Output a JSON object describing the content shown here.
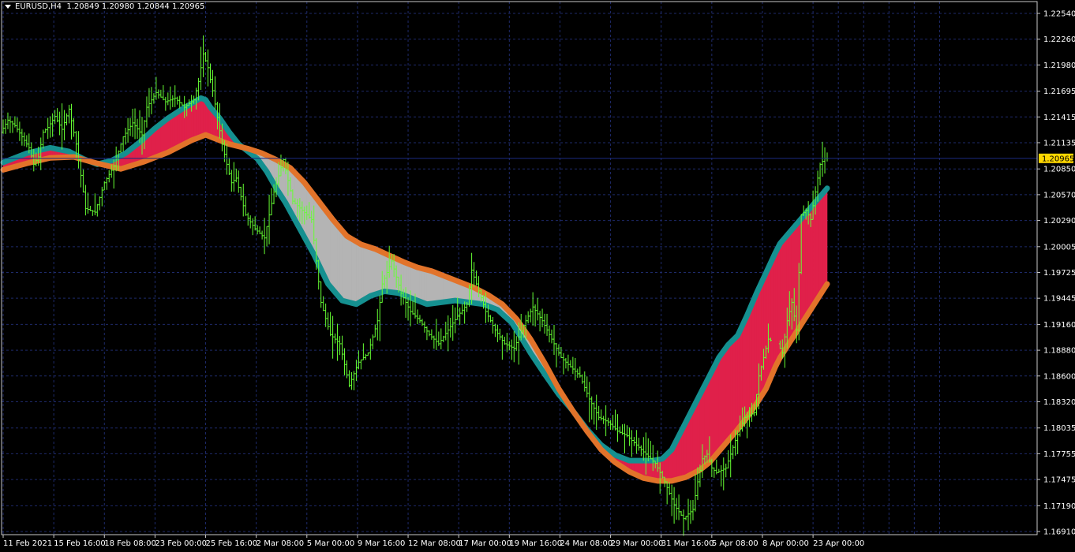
{
  "header": {
    "symbol": "EURUSD,H4",
    "ohlc": "1.20849 1.20980 1.20844 1.20965"
  },
  "colors": {
    "background": "#000000",
    "frame": "#c8c8c8",
    "grid": "#1e2a6a",
    "candle": "#66ff33",
    "fast_ma": "#159090",
    "slow_ma": "#e2732a",
    "bull_fill": "#e0204a",
    "bear_fill": "#b4b4b4",
    "price_line": "#1a2a80",
    "price_tag": "#ffd700"
  },
  "chart_data": {
    "type": "line",
    "current_price": "1.20965",
    "y_ticks": [
      "1.22540",
      "1.22260",
      "1.21980",
      "1.21695",
      "1.21415",
      "1.21135",
      "1.20850",
      "1.20570",
      "1.20290",
      "1.20005",
      "1.19725",
      "1.19445",
      "1.19160",
      "1.18880",
      "1.18600",
      "1.18320",
      "1.18035",
      "1.17755",
      "1.17475",
      "1.17190",
      "1.16910"
    ],
    "x_ticks": [
      "11 Feb 2021",
      "15 Feb 16:00",
      "18 Feb 08:00",
      "23 Feb 00:00",
      "25 Feb 16:00",
      "2 Mar 08:00",
      "5 Mar 00:00",
      "9 Mar 16:00",
      "12 Mar 08:00",
      "17 Mar 00:00",
      "19 Mar 16:00",
      "24 Mar 08:00",
      "29 Mar 00:00",
      "31 Mar 16:00",
      "5 Apr 08:00",
      "8 Apr 00:00",
      "23 Apr 00:00"
    ],
    "ylim": [
      1.1691,
      1.2254
    ],
    "x_index_range": [
      0,
      350
    ],
    "x_tick_index": [
      0,
      21.5,
      43,
      64.5,
      86,
      107.5,
      129,
      150.5,
      172,
      193.5,
      215,
      236.5,
      258,
      279.5,
      301,
      322.5,
      344
    ],
    "series": [
      {
        "key": "price",
        "x": [
          0,
          3,
          6,
          9,
          12,
          14,
          16,
          18,
          20,
          23,
          26,
          29,
          32,
          34,
          36,
          40,
          44,
          48,
          52,
          56,
          60,
          62,
          66,
          70,
          74,
          78,
          82,
          84,
          86,
          88,
          90,
          94,
          96,
          98,
          100,
          104,
          108,
          112,
          116,
          120,
          124,
          128,
          132,
          134,
          136,
          140,
          144,
          148,
          152,
          156,
          160,
          162,
          166,
          170,
          174,
          178,
          182,
          186,
          190,
          194,
          198,
          200,
          202,
          206,
          210,
          214,
          218,
          222,
          226,
          230,
          234,
          238,
          242,
          246,
          250,
          254,
          258,
          262,
          266,
          270,
          274,
          278,
          282,
          286,
          290,
          294,
          296,
          298,
          300,
          302,
          304,
          308,
          312,
          316,
          320,
          322,
          324,
          326,
          330,
          332,
          334,
          336,
          338,
          340,
          342,
          344,
          346,
          348,
          350
        ],
        "y": [
          1.2125,
          1.2138,
          1.2132,
          1.212,
          1.2108,
          1.209,
          1.2098,
          1.2125,
          1.213,
          1.2142,
          1.2128,
          1.215,
          1.2112,
          1.2078,
          1.2042,
          1.2038,
          1.207,
          1.2088,
          1.212,
          1.2135,
          1.2122,
          1.2152,
          1.2168,
          1.2158,
          1.2162,
          1.2152,
          1.216,
          1.218,
          1.221,
          1.2195,
          1.217,
          1.2112,
          1.209,
          1.207,
          1.2075,
          1.2035,
          1.202,
          1.201,
          1.206,
          1.2095,
          1.205,
          1.204,
          1.203,
          1.1985,
          1.194,
          1.1905,
          1.1895,
          1.185,
          1.1875,
          1.1885,
          1.192,
          1.196,
          1.1985,
          1.195,
          1.193,
          1.192,
          1.1905,
          1.1895,
          1.191,
          1.1925,
          1.1938,
          1.1975,
          1.196,
          1.193,
          1.191,
          1.1895,
          1.189,
          1.1915,
          1.1935,
          1.192,
          1.19,
          1.188,
          1.187,
          1.186,
          1.1835,
          1.1815,
          1.181,
          1.18,
          1.1795,
          1.1785,
          1.1775,
          1.1765,
          1.1745,
          1.172,
          1.1705,
          1.1715,
          1.1745,
          1.177,
          1.1775,
          1.176,
          1.1755,
          1.176,
          1.179,
          1.1815,
          1.182,
          1.186,
          1.188,
          1.19,
          1.1895,
          1.1885,
          1.192,
          1.194,
          1.191,
          1.2035,
          1.204,
          1.203,
          1.206,
          1.209,
          1.20965
        ]
      },
      {
        "key": "fast_ma",
        "x": [
          0,
          10,
          20,
          28,
          34,
          40,
          46,
          52,
          58,
          64,
          70,
          76,
          80,
          84,
          86,
          88,
          92,
          96,
          100,
          104,
          108,
          112,
          116,
          120,
          126,
          132,
          138,
          144,
          150,
          156,
          162,
          168,
          174,
          180,
          186,
          192,
          198,
          204,
          210,
          216,
          220,
          224,
          230,
          236,
          242,
          248,
          254,
          260,
          266,
          272,
          276,
          280,
          284,
          288,
          292,
          296,
          300,
          304,
          308,
          312,
          316,
          320,
          324,
          328,
          330,
          332,
          334,
          336,
          338,
          340,
          342,
          344,
          346,
          348,
          350
        ],
        "y": [
          1.2092,
          1.2102,
          1.2108,
          1.2104,
          1.2096,
          1.209,
          1.2094,
          1.2102,
          1.2114,
          1.2128,
          1.214,
          1.215,
          1.2156,
          1.2162,
          1.216,
          1.2152,
          1.214,
          1.2125,
          1.2112,
          1.2104,
          1.2096,
          1.2082,
          1.2064,
          1.2048,
          1.202,
          1.1992,
          1.196,
          1.1942,
          1.1938,
          1.1947,
          1.1952,
          1.195,
          1.1944,
          1.1938,
          1.194,
          1.1942,
          1.194,
          1.1938,
          1.1932,
          1.1918,
          1.1902,
          1.1885,
          1.1862,
          1.184,
          1.1822,
          1.1802,
          1.1785,
          1.1774,
          1.1768,
          1.1768,
          1.1768,
          1.177,
          1.178,
          1.18,
          1.182,
          1.184,
          1.186,
          1.188,
          1.1894,
          1.1904,
          1.1926,
          1.195,
          1.1972,
          1.1994,
          1.2004,
          1.201,
          1.2016,
          1.2022,
          1.2028,
          1.2034,
          1.204,
          1.2046,
          1.2052,
          1.2058,
          1.2064
        ]
      },
      {
        "key": "slow_ma",
        "x": [
          0,
          10,
          20,
          30,
          40,
          50,
          60,
          70,
          80,
          86,
          90,
          96,
          104,
          110,
          116,
          122,
          128,
          134,
          140,
          146,
          152,
          158,
          164,
          170,
          176,
          182,
          188,
          194,
          200,
          206,
          212,
          218,
          224,
          230,
          236,
          242,
          248,
          254,
          260,
          266,
          272,
          278,
          284,
          290,
          296,
          300,
          304,
          308,
          312,
          316,
          320,
          324,
          326,
          328,
          330,
          332,
          334,
          336,
          338,
          340,
          342,
          344,
          346,
          348,
          350
        ],
        "y": [
          1.2084,
          1.2091,
          1.2097,
          1.2098,
          1.2091,
          1.2085,
          1.2093,
          1.2103,
          1.2116,
          1.2122,
          1.2118,
          1.2112,
          1.2107,
          1.2102,
          1.2095,
          1.2086,
          1.207,
          1.205,
          1.203,
          1.2012,
          1.2003,
          1.1998,
          1.1991,
          1.1984,
          1.1978,
          1.1974,
          1.1968,
          1.1962,
          1.1956,
          1.1948,
          1.1938,
          1.1922,
          1.19,
          1.1874,
          1.1846,
          1.1822,
          1.18,
          1.178,
          1.1766,
          1.1756,
          1.1749,
          1.1746,
          1.1746,
          1.175,
          1.1758,
          1.1766,
          1.1778,
          1.179,
          1.1802,
          1.1815,
          1.183,
          1.1846,
          1.1858,
          1.187,
          1.188,
          1.1888,
          1.1896,
          1.1904,
          1.1912,
          1.192,
          1.1928,
          1.1936,
          1.1944,
          1.1952,
          1.196
        ]
      }
    ],
    "grid": true
  }
}
